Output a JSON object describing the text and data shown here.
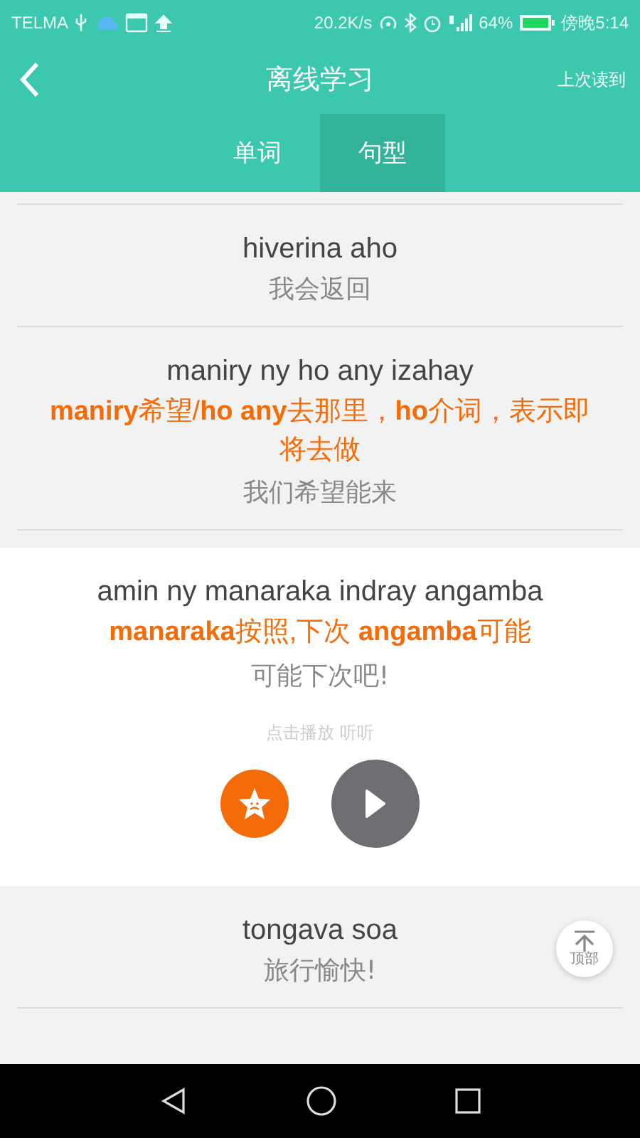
{
  "status_bar": {
    "carrier": "TELMA",
    "speed": "20.2K/s",
    "battery": "64%",
    "time": "傍晚5:14"
  },
  "header": {
    "title": "离线学习",
    "action": "上次读到"
  },
  "tabs": [
    {
      "label": "单词",
      "selected": false
    },
    {
      "label": "句型",
      "selected": true
    }
  ],
  "sentences": [
    {
      "text": "hiverina aho",
      "translation": "我会返回",
      "expanded": false
    },
    {
      "text": "maniry ny ho any izahay",
      "note": "**maniry**希望/**ho any**去那里，**ho**介词，表示即将去做",
      "translation": "我们希望能来",
      "expanded": false
    },
    {
      "text": "amin ny manaraka indray angamba",
      "note": "**manaraka**按照,下次 **angamba**可能",
      "translation": "可能下次吧!",
      "expanded": true,
      "hint": "点击播放 听听"
    },
    {
      "text": "tongava soa",
      "translation": "旅行愉快!",
      "expanded": false
    }
  ],
  "top_button": {
    "label": "顶部"
  }
}
